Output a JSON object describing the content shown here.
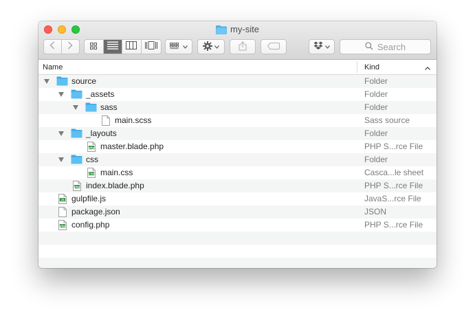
{
  "window": {
    "title": "my-site"
  },
  "toolbar": {
    "search_placeholder": "Search"
  },
  "header": {
    "name": "Name",
    "kind": "Kind"
  },
  "icons": {
    "back": "chevron-left-icon",
    "forward": "chevron-right-icon",
    "view_icons": "icon-view-icon",
    "view_list": "list-view-icon",
    "view_columns": "column-view-icon",
    "view_coverflow": "coverflow-view-icon",
    "arrange": "arrange-icon",
    "action": "gear-icon",
    "share": "share-icon",
    "tags": "tag-icon",
    "dropbox": "dropbox-icon",
    "search": "search-icon"
  },
  "colors": {
    "folder": "#4fb7f0",
    "list_view_active": "#6c6c6c",
    "close": "#fc5f57",
    "minimize": "#fdbc2e",
    "maximize": "#29c840"
  },
  "files": [
    {
      "name": "source",
      "kind": "Folder",
      "depth": 0,
      "type": "folder",
      "expanded": true
    },
    {
      "name": "_assets",
      "kind": "Folder",
      "depth": 1,
      "type": "folder",
      "expanded": true
    },
    {
      "name": "sass",
      "kind": "Folder",
      "depth": 2,
      "type": "folder",
      "expanded": true
    },
    {
      "name": "main.scss",
      "kind": "Sass source",
      "depth": 3,
      "type": "doc"
    },
    {
      "name": "_layouts",
      "kind": "Folder",
      "depth": 1,
      "type": "folder",
      "expanded": true
    },
    {
      "name": "master.blade.php",
      "kind": "PHP S...rce File",
      "depth": 2,
      "type": "php"
    },
    {
      "name": "css",
      "kind": "Folder",
      "depth": 1,
      "type": "folder",
      "expanded": true
    },
    {
      "name": "main.css",
      "kind": "Casca...le sheet",
      "depth": 2,
      "type": "css"
    },
    {
      "name": "index.blade.php",
      "kind": "PHP S...rce File",
      "depth": 1,
      "type": "php"
    },
    {
      "name": "gulpfile.js",
      "kind": "JavaS...rce File",
      "depth": 0,
      "type": "js"
    },
    {
      "name": "package.json",
      "kind": "JSON",
      "depth": 0,
      "type": "doc"
    },
    {
      "name": "config.php",
      "kind": "PHP S...rce File",
      "depth": 0,
      "type": "php"
    }
  ],
  "icon_labels": {
    "php": "php",
    "js": "JS",
    "css": "CSS"
  }
}
